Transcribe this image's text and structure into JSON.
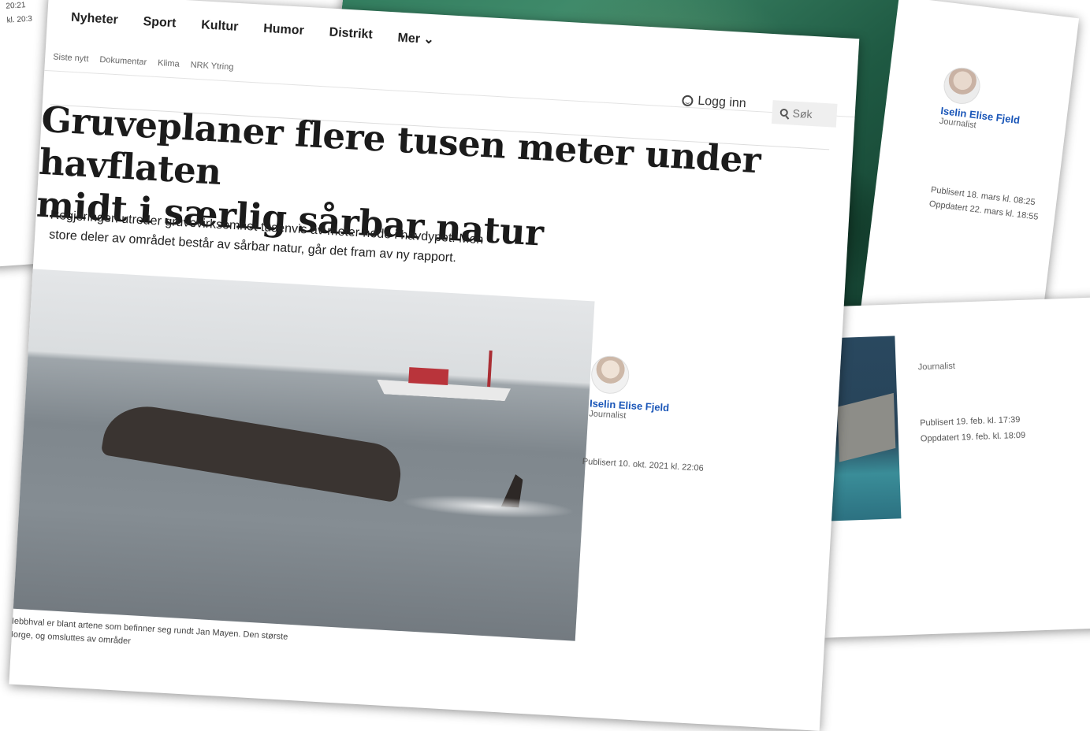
{
  "left_page": {
    "timestamps": [
      "20:21",
      "kl. 20:3"
    ]
  },
  "right_page": {
    "author_name": "Iselin Elise Fjeld",
    "author_role": "Journalist",
    "published": "Publisert 18. mars kl. 08:25",
    "updated": "Oppdatert 22. mars kl. 18:55"
  },
  "mid_page": {
    "author_role": "Journalist",
    "published": "Publisert 19. feb. kl. 17:39",
    "updated": "Oppdatert 19. feb. kl. 18:09"
  },
  "main_page": {
    "nav": {
      "items": [
        "Nyheter",
        "Sport",
        "Kultur",
        "Humor",
        "Distrikt",
        "Mer ⌄"
      ]
    },
    "subnav": {
      "items": [
        "Siste nytt",
        "Dokumentar",
        "Klima",
        "NRK Ytring"
      ]
    },
    "login_label": "Logg inn",
    "search": {
      "placeholder": "Søk"
    },
    "headline_line1": "Gruveplaner flere tusen meter under havflaten",
    "headline_line2": "midt i særlig sårbar natur",
    "lede_line1": "Regjeringen utreder gruvevirksomhet tusenvis av meter nede i havdypet. Men",
    "lede_line2": "store deler av området består av sårbar natur, går det fram av ny rapport.",
    "caption_line1": "Nebbhval er blant artene som befinner seg rundt Jan Mayen. Den største",
    "caption_line2": "Norge, og omsluttes av områder",
    "author_name": "Iselin Elise Fjeld",
    "author_role": "Journalist",
    "published": "Publisert 10. okt. 2021 kl. 22:06"
  }
}
